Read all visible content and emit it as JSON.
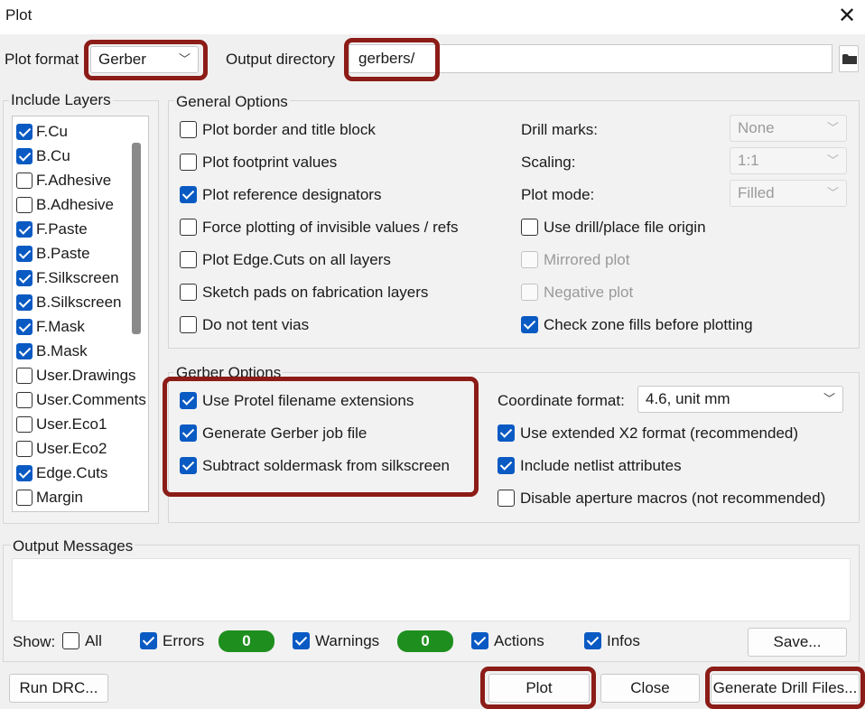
{
  "window": {
    "title": "Plot"
  },
  "top": {
    "plot_format_label": "Plot format",
    "plot_format_value": "Gerber",
    "output_dir_label": "Output directory",
    "output_dir_value": "gerbers/"
  },
  "include_layers": {
    "title": "Include Layers",
    "items": [
      {
        "label": "F.Cu",
        "checked": true
      },
      {
        "label": "B.Cu",
        "checked": true
      },
      {
        "label": "F.Adhesive",
        "checked": false
      },
      {
        "label": "B.Adhesive",
        "checked": false
      },
      {
        "label": "F.Paste",
        "checked": true
      },
      {
        "label": "B.Paste",
        "checked": true
      },
      {
        "label": "F.Silkscreen",
        "checked": true
      },
      {
        "label": "B.Silkscreen",
        "checked": true
      },
      {
        "label": "F.Mask",
        "checked": true
      },
      {
        "label": "B.Mask",
        "checked": true
      },
      {
        "label": "User.Drawings",
        "checked": false
      },
      {
        "label": "User.Comments",
        "checked": false
      },
      {
        "label": "User.Eco1",
        "checked": false
      },
      {
        "label": "User.Eco2",
        "checked": false
      },
      {
        "label": "Edge.Cuts",
        "checked": true
      },
      {
        "label": "Margin",
        "checked": false
      }
    ]
  },
  "general": {
    "title": "General Options",
    "left": [
      {
        "label": "Plot border and title block",
        "checked": false
      },
      {
        "label": "Plot footprint values",
        "checked": false
      },
      {
        "label": "Plot reference designators",
        "checked": true
      },
      {
        "label": "Force plotting of invisible values / refs",
        "checked": false
      },
      {
        "label": "Plot Edge.Cuts on all layers",
        "checked": false
      },
      {
        "label": "Sketch pads on fabrication layers",
        "checked": false
      },
      {
        "label": "Do not tent vias",
        "checked": false
      }
    ],
    "drill_marks_label": "Drill marks:",
    "drill_marks_value": "None",
    "scaling_label": "Scaling:",
    "scaling_value": "1:1",
    "plot_mode_label": "Plot mode:",
    "plot_mode_value": "Filled",
    "right": [
      {
        "label": "Use drill/place file origin",
        "checked": false,
        "disabled": false
      },
      {
        "label": "Mirrored plot",
        "checked": false,
        "disabled": true
      },
      {
        "label": "Negative plot",
        "checked": false,
        "disabled": true
      },
      {
        "label": "Check zone fills before plotting",
        "checked": true,
        "disabled": false
      }
    ]
  },
  "gerber": {
    "title": "Gerber Options",
    "left": [
      {
        "label": "Use Protel filename extensions",
        "checked": true
      },
      {
        "label": "Generate Gerber job file",
        "checked": true
      },
      {
        "label": "Subtract soldermask from silkscreen",
        "checked": true
      }
    ],
    "coord_label": "Coordinate format:",
    "coord_value": "4.6, unit mm",
    "right": [
      {
        "label": "Use extended X2 format (recommended)",
        "checked": true
      },
      {
        "label": "Include netlist attributes",
        "checked": true
      },
      {
        "label": "Disable aperture macros (not recommended)",
        "checked": false
      }
    ]
  },
  "messages": {
    "title": "Output Messages",
    "show_label": "Show:",
    "all_label": "All",
    "all_checked": false,
    "errors_label": "Errors",
    "errors_checked": true,
    "errors_count": "0",
    "warnings_label": "Warnings",
    "warnings_checked": true,
    "warnings_count": "0",
    "actions_label": "Actions",
    "actions_checked": true,
    "infos_label": "Infos",
    "infos_checked": true,
    "save_label": "Save..."
  },
  "buttons": {
    "run_drc": "Run DRC...",
    "plot": "Plot",
    "close": "Close",
    "generate_drill": "Generate Drill Files..."
  },
  "colors": {
    "accent": "#0a5ac3",
    "highlight": "#8c1c17",
    "badge": "#1e8f1e"
  }
}
